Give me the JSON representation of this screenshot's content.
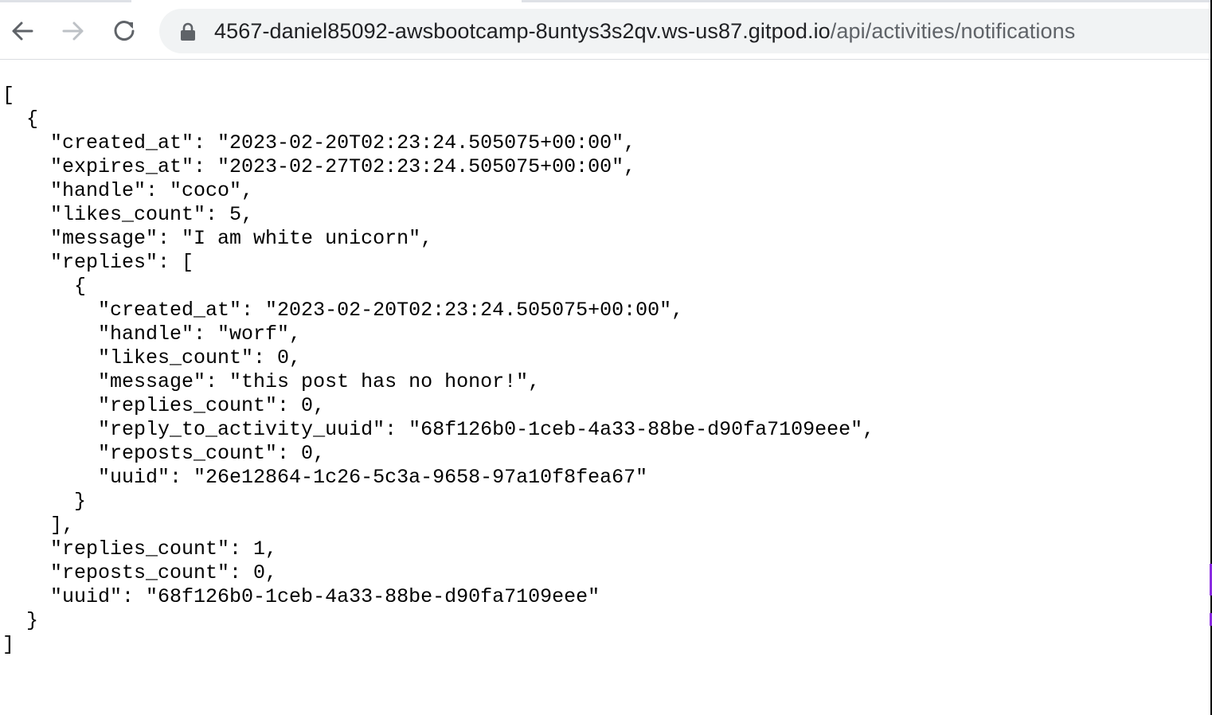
{
  "browser": {
    "nav": {
      "back_icon": "arrow-left-icon",
      "forward_icon": "arrow-right-icon",
      "reload_icon": "reload-icon"
    },
    "omnibox": {
      "secure_icon": "lock-icon",
      "host": "4567-daniel85092-awsbootcamp-8untys3s2qv.ws-us87.gitpod.io",
      "path": "/api/activities/notifications"
    }
  },
  "response": {
    "lines": [
      "[",
      "  {",
      "    \"created_at\": \"2023-02-20T02:23:24.505075+00:00\",",
      "    \"expires_at\": \"2023-02-27T02:23:24.505075+00:00\",",
      "    \"handle\": \"coco\",",
      "    \"likes_count\": 5,",
      "    \"message\": \"I am white unicorn\",",
      "    \"replies\": [",
      "      {",
      "        \"created_at\": \"2023-02-20T02:23:24.505075+00:00\",",
      "        \"handle\": \"worf\",",
      "        \"likes_count\": 0,",
      "        \"message\": \"this post has no honor!\",",
      "        \"replies_count\": 0,",
      "        \"reply_to_activity_uuid\": \"68f126b0-1ceb-4a33-88be-d90fa7109eee\",",
      "        \"reposts_count\": 0,",
      "        \"uuid\": \"26e12864-1c26-5c3a-9658-97a10f8fea67\"",
      "      }",
      "    ],",
      "    \"replies_count\": 1,",
      "    \"reposts_count\": 0,",
      "    \"uuid\": \"68f126b0-1ceb-4a33-88be-d90fa7109eee\"",
      "  }",
      "]"
    ]
  },
  "colors": {
    "host_text": "#202124",
    "path_text": "#5f6368",
    "omnibox_bg": "#f1f3f4",
    "icon": "#5f6368",
    "icon_disabled": "#bdc1c6"
  }
}
